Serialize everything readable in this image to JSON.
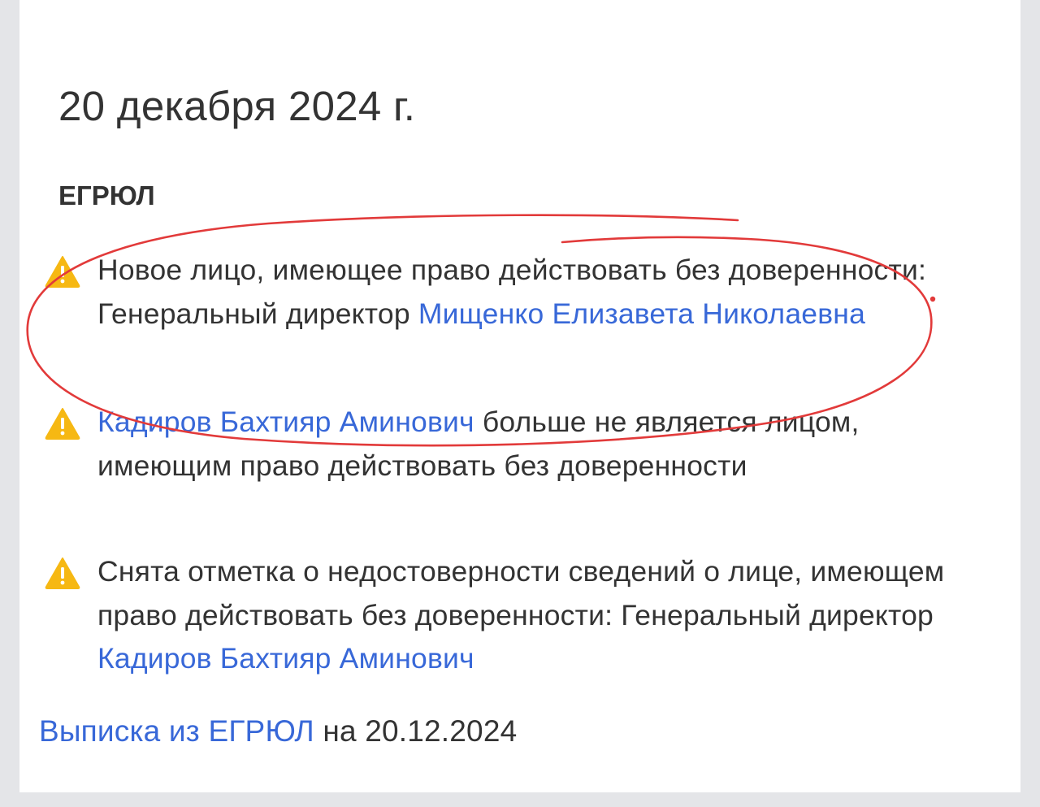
{
  "header": {
    "date": "20 декабря 2024 г.",
    "source": "ЕГРЮЛ"
  },
  "events": [
    {
      "icon": "warning-icon",
      "text_before": "Новое лицо, имеющее право действовать без доверенности: Генеральный директор ",
      "person": "Мищенко Елизавета Николаевна",
      "text_after": ""
    },
    {
      "icon": "warning-icon",
      "text_before": "",
      "person": "Кадиров Бахтияр Аминович",
      "text_after": " больше не является лицом, имеющим право действовать без доверенности"
    },
    {
      "icon": "warning-icon",
      "text_before": "Снята отметка о недостоверности сведений о лице, имеющем право действовать без доверенности: Генеральный директор ",
      "person": "Кадиров Бахтияр Аминович",
      "text_after": ""
    }
  ],
  "footer": {
    "link": "Выписка из ЕГРЮЛ",
    "suffix": " на 20.12.2024"
  },
  "colors": {
    "text": "#333333",
    "link": "#3868d8",
    "warning": "#f6b813",
    "annotation": "#e23a3a",
    "background": "#e4e5e8",
    "card": "#ffffff"
  }
}
